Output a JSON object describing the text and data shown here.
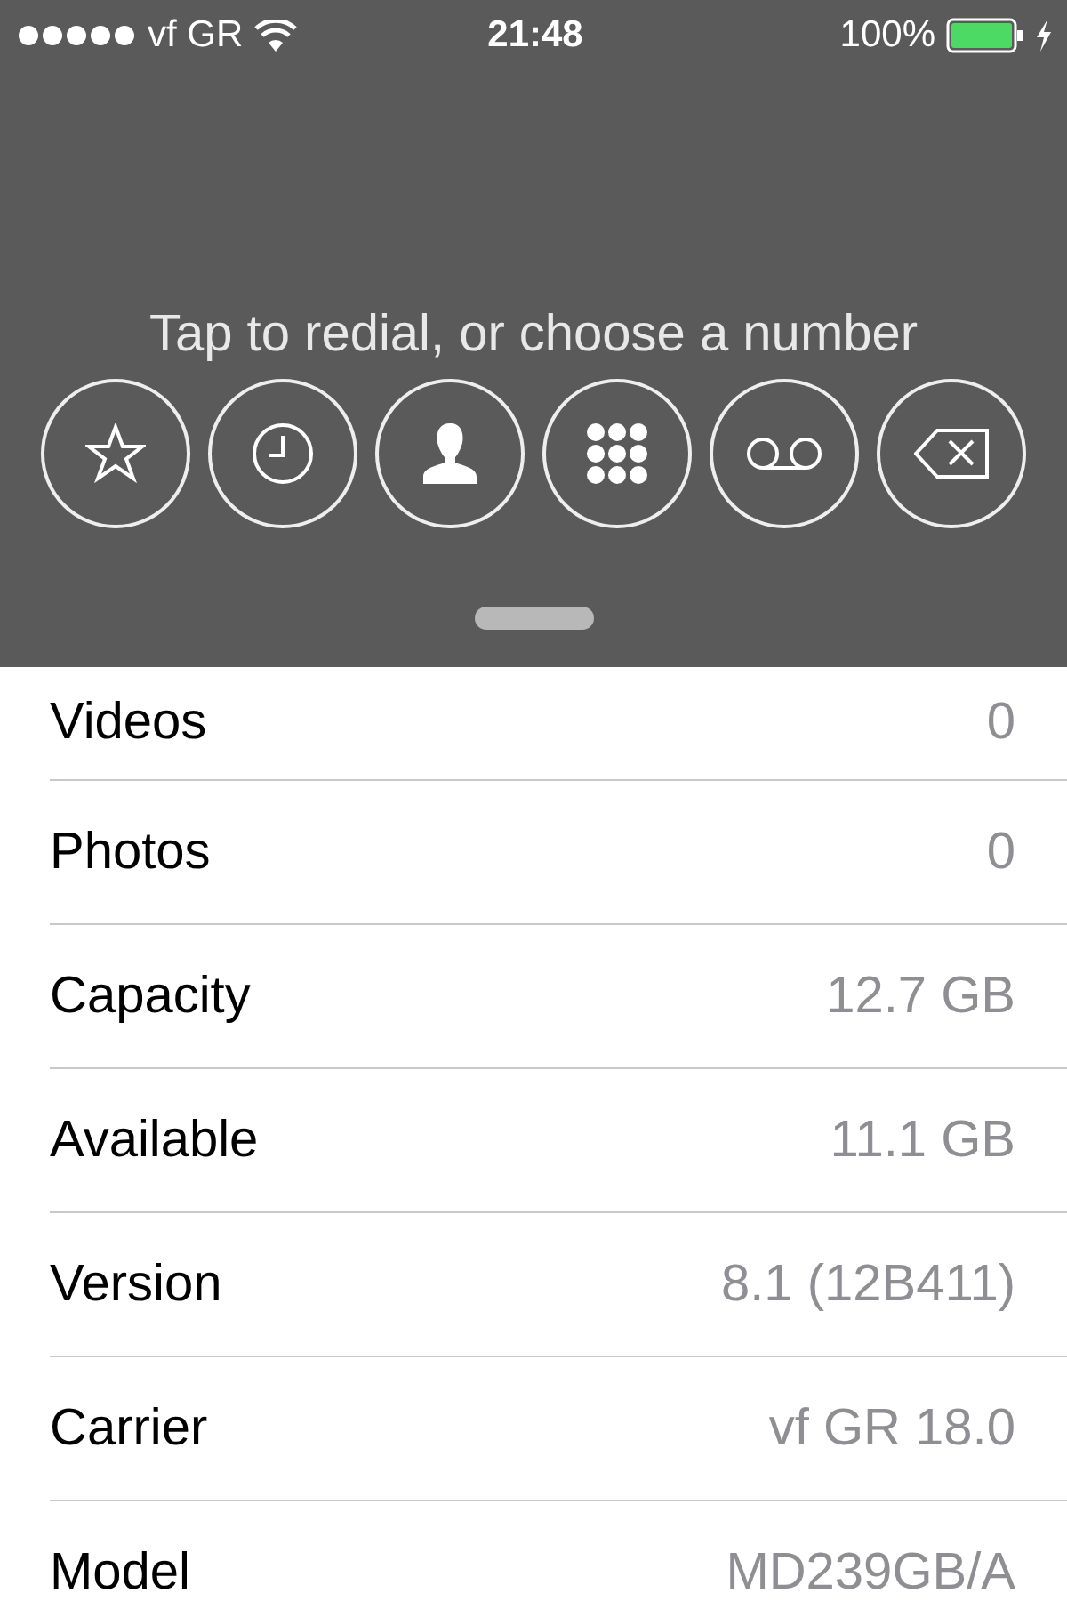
{
  "status_bar": {
    "carrier": "vf GR",
    "time": "21:48",
    "battery": "100%"
  },
  "dialer": {
    "prompt": "Tap to redial, or choose a number",
    "buttons": [
      {
        "kind": "favorites"
      },
      {
        "kind": "recents"
      },
      {
        "kind": "contacts"
      },
      {
        "kind": "keypad"
      },
      {
        "kind": "voicemail"
      },
      {
        "kind": "delete"
      }
    ]
  },
  "rows": [
    {
      "label": "Videos",
      "value": "0"
    },
    {
      "label": "Photos",
      "value": "0"
    },
    {
      "label": "Capacity",
      "value": "12.7 GB"
    },
    {
      "label": "Available",
      "value": "11.1 GB"
    },
    {
      "label": "Version",
      "value": "8.1 (12B411)"
    },
    {
      "label": "Carrier",
      "value": "vf GR 18.0"
    },
    {
      "label": "Model",
      "value": "MD239GB/A"
    }
  ]
}
